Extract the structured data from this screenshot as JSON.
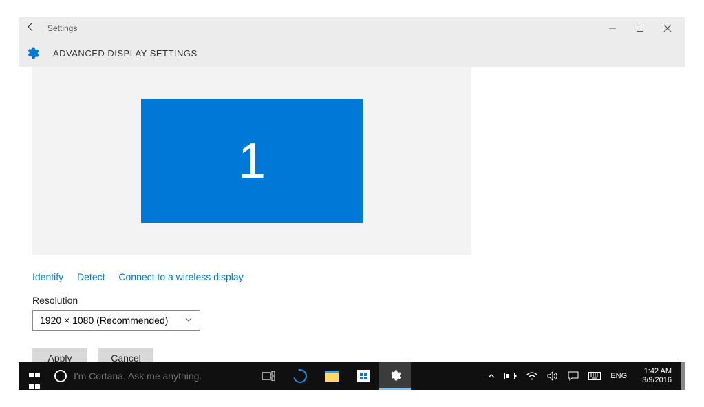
{
  "window": {
    "title": "Settings",
    "page_title": "ADVANCED DISPLAY SETTINGS"
  },
  "monitor": {
    "label": "1"
  },
  "links": {
    "identify": "Identify",
    "detect": "Detect",
    "wireless": "Connect to a wireless display"
  },
  "resolution": {
    "label": "Resolution",
    "value": "1920 × 1080 (Recommended)"
  },
  "buttons": {
    "apply": "Apply",
    "cancel": "Cancel"
  },
  "taskbar": {
    "cortana_placeholder": "I'm Cortana. Ask me anything.",
    "lang": "ENG",
    "time": "1:42 AM",
    "date": "3/9/2016"
  }
}
